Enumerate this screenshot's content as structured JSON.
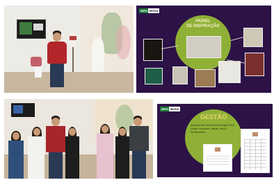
{
  "slide_top": {
    "title": "PAINEL\nDE INSPIRAÇÃO",
    "badge_left": "IMPA",
    "badge_right": "MODA"
  },
  "slide_bottom": {
    "title": "GESTÃO",
    "body": "Incluído em nível pelo Google Drive (fotos, insumos, peças, etc) e ferramentas.",
    "badge_left": "IMPA",
    "badge_right": "MODA"
  },
  "colors": {
    "slide_bg": "#2c1246",
    "accent_green": "#8fb036",
    "title_yellow": "#e6d76a"
  }
}
